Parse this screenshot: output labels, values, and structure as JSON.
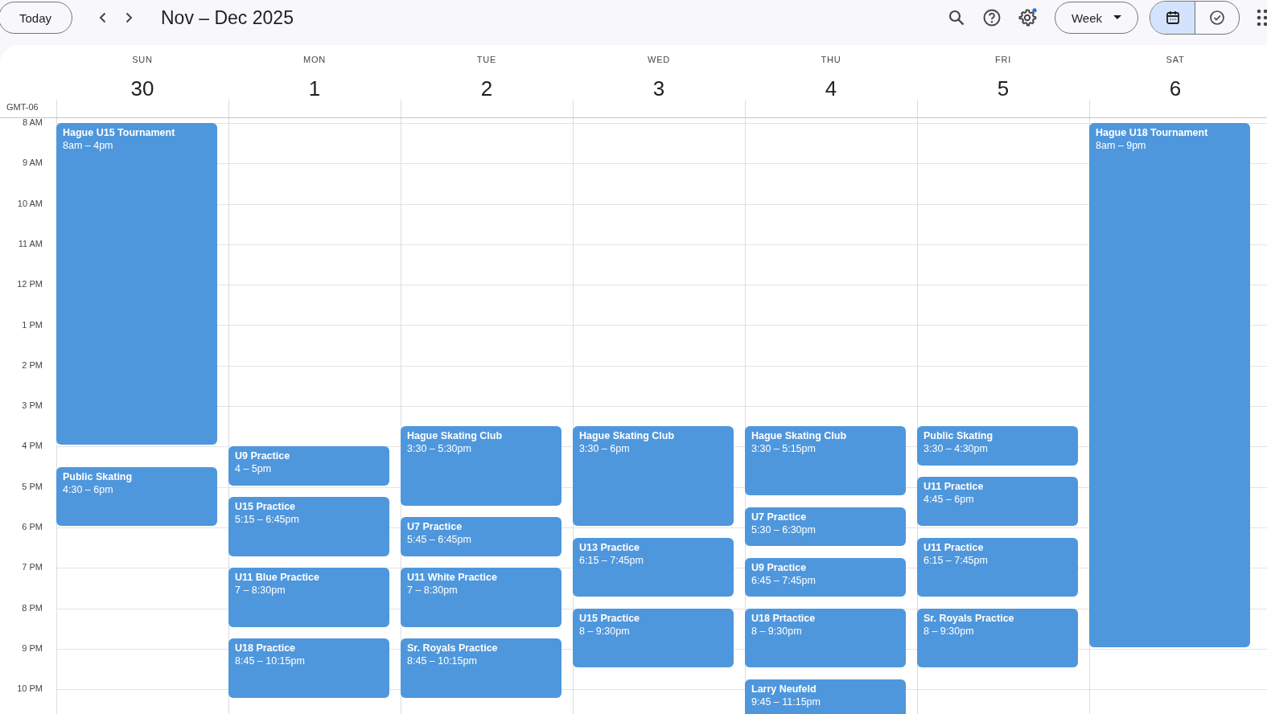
{
  "toolbar": {
    "today_button": "Today",
    "title": "Nov – Dec 2025",
    "view_dropdown": "Week",
    "view_toggle": [
      {
        "kind": "calendar",
        "selected": true
      },
      {
        "kind": "tasks",
        "selected": false
      }
    ]
  },
  "timezone": "GMT-06",
  "hours": [
    "8 AM",
    "9 AM",
    "10 AM",
    "11 AM",
    "12 PM",
    "1 PM",
    "2 PM",
    "3 PM",
    "4 PM",
    "5 PM",
    "6 PM",
    "7 PM",
    "8 PM",
    "9 PM",
    "10 PM"
  ],
  "days": [
    {
      "weekday": "SUN",
      "date": "30",
      "events": [
        {
          "title": "Hague U15 Tournament",
          "time": "8am – 4pm"
        },
        {
          "title": "Public Skating",
          "time": "4:30 – 6pm"
        }
      ]
    },
    {
      "weekday": "MON",
      "date": "1",
      "events": [
        {
          "title": "U9 Practice",
          "time": "4 – 5pm"
        },
        {
          "title": "U15 Practice",
          "time": "5:15 – 6:45pm"
        },
        {
          "title": "U11 Blue Practice",
          "time": "7 – 8:30pm"
        },
        {
          "title": "U18 Practice",
          "time": "8:45 – 10:15pm"
        }
      ]
    },
    {
      "weekday": "TUE",
      "date": "2",
      "events": [
        {
          "title": "Hague Skating Club",
          "time": "3:30 – 5:30pm"
        },
        {
          "title": "U7 Practice",
          "time": "5:45 – 6:45pm"
        },
        {
          "title": "U11 White Practice",
          "time": "7 – 8:30pm"
        },
        {
          "title": "Sr. Royals Practice",
          "time": "8:45 – 10:15pm"
        }
      ]
    },
    {
      "weekday": "WED",
      "date": "3",
      "events": [
        {
          "title": "Hague Skating Club",
          "time": "3:30 – 6pm"
        },
        {
          "title": "U13 Practice",
          "time": "6:15 – 7:45pm"
        },
        {
          "title": "U15 Practice",
          "time": "8 – 9:30pm"
        }
      ]
    },
    {
      "weekday": "THU",
      "date": "4",
      "events": [
        {
          "title": "Hague Skating Club",
          "time": "3:30 – 5:15pm"
        },
        {
          "title": "U7 Practice",
          "time": "5:30 – 6:30pm"
        },
        {
          "title": "U9 Practice",
          "time": "6:45 – 7:45pm"
        },
        {
          "title": "U18 Prtactice",
          "time": "8 – 9:30pm"
        },
        {
          "title": "Larry Neufeld",
          "time": "9:45 – 11:15pm"
        }
      ]
    },
    {
      "weekday": "FRI",
      "date": "5",
      "events": [
        {
          "title": "Public Skating",
          "time": "3:30 – 4:30pm"
        },
        {
          "title": "U11 Practice",
          "time": "4:45 – 6pm"
        },
        {
          "title": "U11 Practice",
          "time": "6:15 – 7:45pm"
        },
        {
          "title": "Sr. Royals Practice",
          "time": "8 – 9:30pm"
        }
      ]
    },
    {
      "weekday": "SAT",
      "date": "6",
      "events": [
        {
          "title": "Hague U18 Tournament",
          "time": "8am – 9pm"
        }
      ]
    }
  ]
}
